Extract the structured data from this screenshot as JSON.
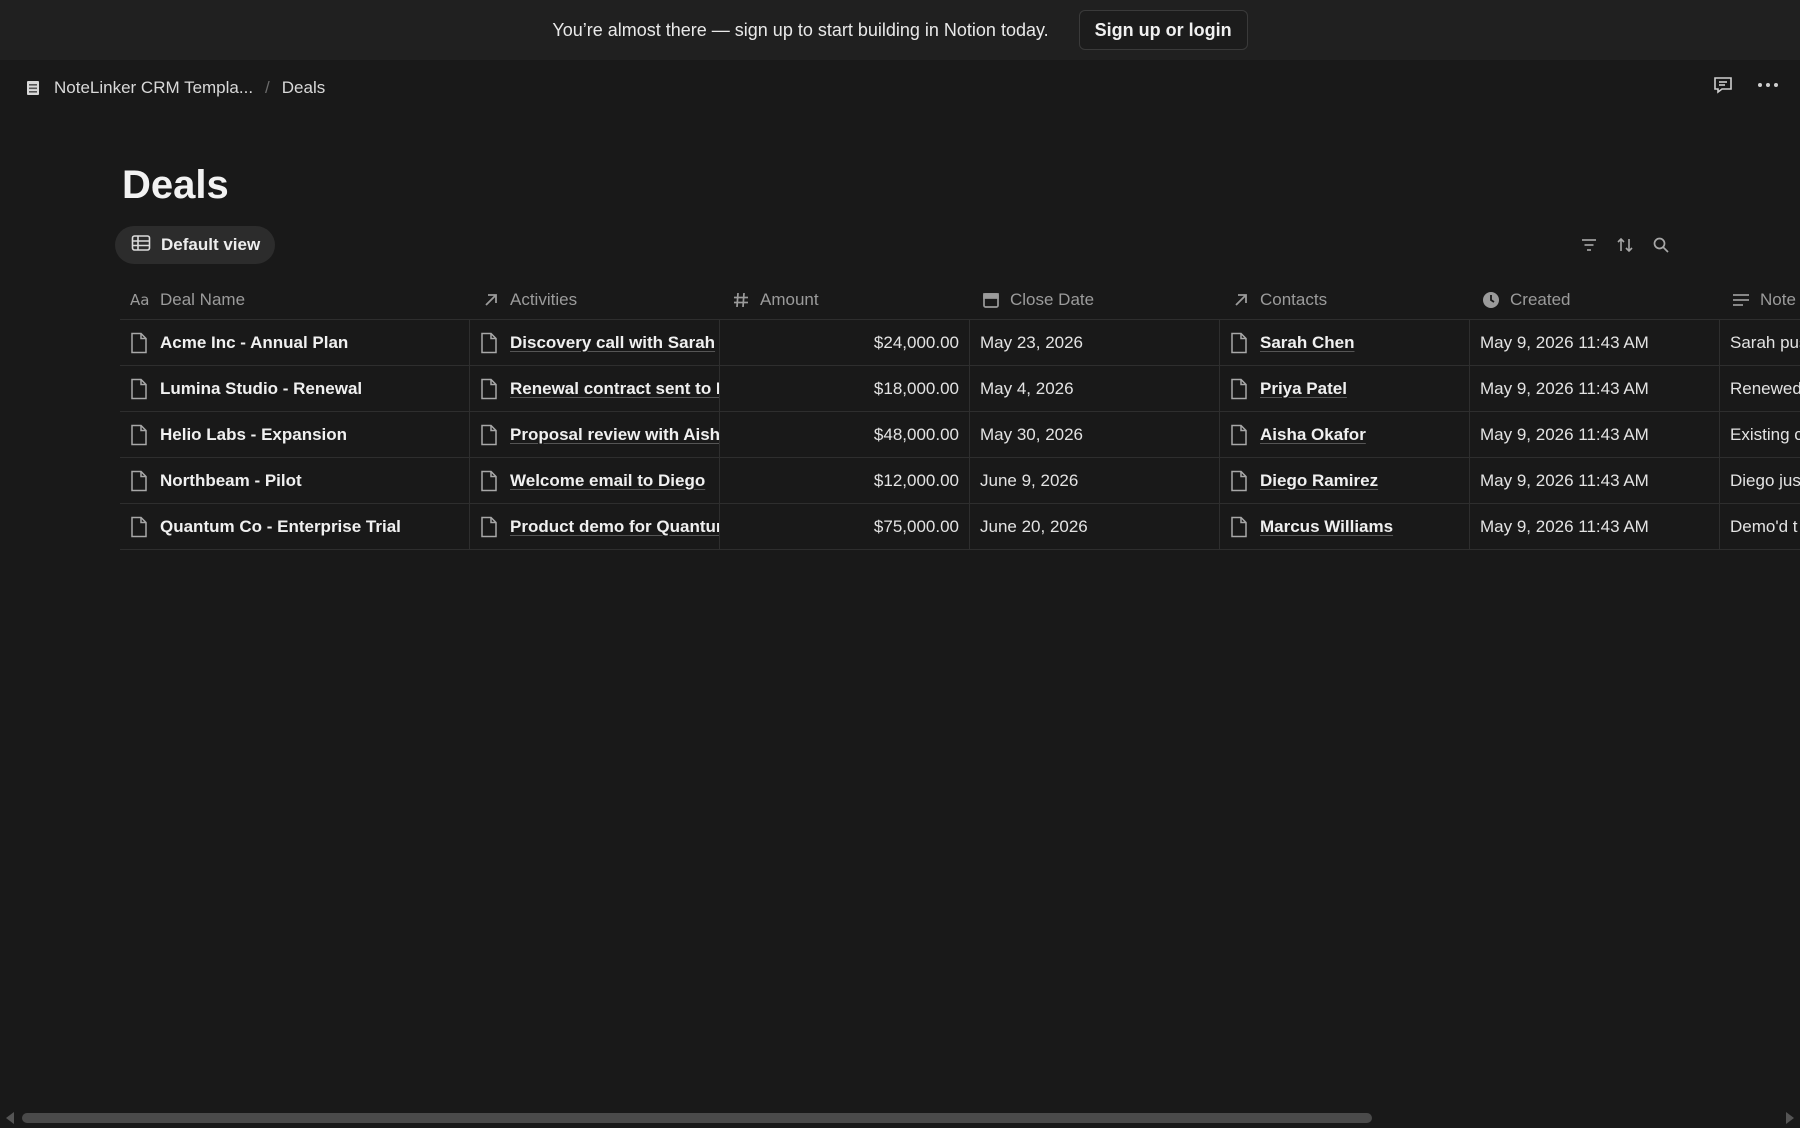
{
  "banner": {
    "text": "You’re almost there — sign up to start building in Notion today.",
    "button": "Sign up or login"
  },
  "breadcrumb": {
    "parent": "NoteLinker CRM Templa...",
    "separator": "/",
    "current": "Deals"
  },
  "page": {
    "title": "Deals",
    "view_label": "Default view"
  },
  "table": {
    "columns": [
      {
        "label": "Deal Name",
        "icon": "text-aa-icon"
      },
      {
        "label": "Activities",
        "icon": "relation-arrow-icon"
      },
      {
        "label": "Amount",
        "icon": "number-hash-icon"
      },
      {
        "label": "Close Date",
        "icon": "calendar-icon"
      },
      {
        "label": "Contacts",
        "icon": "relation-arrow-icon"
      },
      {
        "label": "Created",
        "icon": "clock-icon"
      },
      {
        "label": "Note",
        "icon": "text-lines-icon"
      }
    ],
    "rows": [
      {
        "deal": "Acme Inc - Annual Plan",
        "activity": "Discovery call with Sarah",
        "amount": "$24,000.00",
        "close": "May 23, 2026",
        "contact": "Sarah Chen",
        "created": "May 9, 2026 11:43 AM",
        "note": "Sarah pus"
      },
      {
        "deal": "Lumina Studio - Renewal",
        "activity": "Renewal contract sent to P",
        "amount": "$18,000.00",
        "close": "May 4, 2026",
        "contact": "Priya Patel",
        "created": "May 9, 2026 11:43 AM",
        "note": "Renewed"
      },
      {
        "deal": "Helio Labs - Expansion",
        "activity": "Proposal review with Aisha",
        "amount": "$48,000.00",
        "close": "May 30, 2026",
        "contact": "Aisha Okafor",
        "created": "May 9, 2026 11:43 AM",
        "note": "Existing c"
      },
      {
        "deal": "Northbeam - Pilot",
        "activity": "Welcome email to Diego",
        "amount": "$12,000.00",
        "close": "June 9, 2026",
        "contact": "Diego Ramirez",
        "created": "May 9, 2026 11:43 AM",
        "note": "Diego jus"
      },
      {
        "deal": "Quantum Co - Enterprise Trial",
        "activity": "Product demo for Quantur",
        "amount": "$75,000.00",
        "close": "June 20, 2026",
        "contact": "Marcus Williams",
        "created": "May 9, 2026 11:43 AM",
        "note": "Demo'd t"
      }
    ]
  },
  "colors": {
    "background": "#191919",
    "banner": "#202020",
    "text": "#e6e6e6",
    "muted": "#9b9b9b"
  }
}
